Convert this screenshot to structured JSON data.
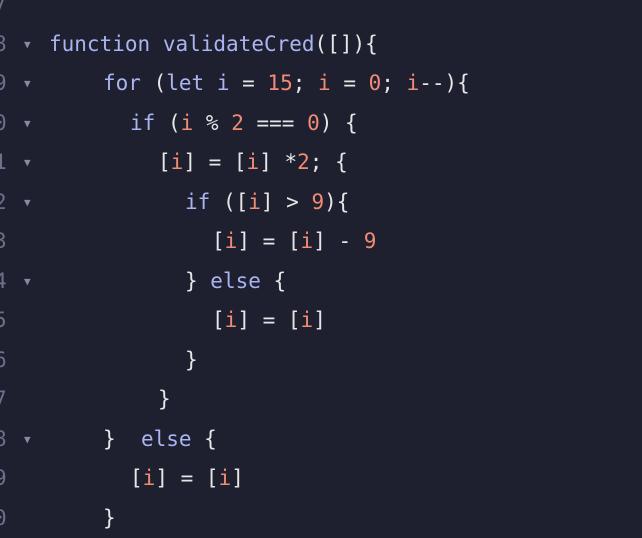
{
  "editor": {
    "fold_glyph": "▼",
    "lines": [
      {
        "no": "7",
        "fold": false,
        "indent": 0,
        "tokens": []
      },
      {
        "no": "8",
        "fold": true,
        "indent": 0,
        "tokens": [
          {
            "t": "function",
            "c": "kw"
          },
          {
            "t": " ",
            "c": "pun"
          },
          {
            "t": "validateCred",
            "c": "fn"
          },
          {
            "t": "([]){",
            "c": "pun"
          }
        ]
      },
      {
        "no": "9",
        "fold": true,
        "indent": 1,
        "tokens": [
          {
            "t": "for",
            "c": "kw"
          },
          {
            "t": " (",
            "c": "pun"
          },
          {
            "t": "let",
            "c": "kw"
          },
          {
            "t": " ",
            "c": "pun"
          },
          {
            "t": "i",
            "c": "fn"
          },
          {
            "t": " = ",
            "c": "pun"
          },
          {
            "t": "15",
            "c": "num"
          },
          {
            "t": "; ",
            "c": "pun"
          },
          {
            "t": "i",
            "c": "var"
          },
          {
            "t": " = ",
            "c": "pun"
          },
          {
            "t": "0",
            "c": "num"
          },
          {
            "t": "; ",
            "c": "pun"
          },
          {
            "t": "i",
            "c": "var"
          },
          {
            "t": "--){",
            "c": "pun"
          }
        ]
      },
      {
        "no": "0",
        "fold": true,
        "indent": 2,
        "tokens": [
          {
            "t": "if",
            "c": "kw"
          },
          {
            "t": " (",
            "c": "pun"
          },
          {
            "t": "i",
            "c": "var"
          },
          {
            "t": " % ",
            "c": "pun"
          },
          {
            "t": "2",
            "c": "num"
          },
          {
            "t": " === ",
            "c": "pun"
          },
          {
            "t": "0",
            "c": "num"
          },
          {
            "t": ") {",
            "c": "pun"
          }
        ]
      },
      {
        "no": "1",
        "fold": true,
        "indent": 3,
        "tokens": [
          {
            "t": "[",
            "c": "pun"
          },
          {
            "t": "i",
            "c": "var"
          },
          {
            "t": "] = [",
            "c": "pun"
          },
          {
            "t": "i",
            "c": "var"
          },
          {
            "t": "] *",
            "c": "pun"
          },
          {
            "t": "2",
            "c": "num"
          },
          {
            "t": "; {",
            "c": "pun"
          }
        ]
      },
      {
        "no": "2",
        "fold": true,
        "indent": 4,
        "tokens": [
          {
            "t": "if",
            "c": "kw"
          },
          {
            "t": " ([",
            "c": "pun"
          },
          {
            "t": "i",
            "c": "var"
          },
          {
            "t": "] > ",
            "c": "pun"
          },
          {
            "t": "9",
            "c": "num"
          },
          {
            "t": "){",
            "c": "pun"
          }
        ]
      },
      {
        "no": "3",
        "fold": false,
        "indent": 5,
        "tokens": [
          {
            "t": "[",
            "c": "pun"
          },
          {
            "t": "i",
            "c": "var"
          },
          {
            "t": "] = [",
            "c": "pun"
          },
          {
            "t": "i",
            "c": "var"
          },
          {
            "t": "] - ",
            "c": "pun"
          },
          {
            "t": "9",
            "c": "num"
          }
        ]
      },
      {
        "no": "4",
        "fold": true,
        "indent": 4,
        "tokens": [
          {
            "t": "} ",
            "c": "pun"
          },
          {
            "t": "else",
            "c": "kw"
          },
          {
            "t": " {",
            "c": "pun"
          }
        ]
      },
      {
        "no": "5",
        "fold": false,
        "indent": 5,
        "tokens": [
          {
            "t": "[",
            "c": "pun"
          },
          {
            "t": "i",
            "c": "var"
          },
          {
            "t": "] = [",
            "c": "pun"
          },
          {
            "t": "i",
            "c": "var"
          },
          {
            "t": "]",
            "c": "pun"
          }
        ]
      },
      {
        "no": "6",
        "fold": false,
        "indent": 4,
        "tokens": [
          {
            "t": "}",
            "c": "pun"
          }
        ]
      },
      {
        "no": "7",
        "fold": false,
        "indent": 3,
        "tokens": [
          {
            "t": "}",
            "c": "pun"
          }
        ]
      },
      {
        "no": "8",
        "fold": true,
        "indent": 1,
        "tokens": [
          {
            "t": "}  ",
            "c": "pun"
          },
          {
            "t": "else",
            "c": "kw"
          },
          {
            "t": " {",
            "c": "pun"
          }
        ]
      },
      {
        "no": "9",
        "fold": false,
        "indent": 2,
        "tokens": [
          {
            "t": "[",
            "c": "pun"
          },
          {
            "t": "i",
            "c": "var"
          },
          {
            "t": "] = [",
            "c": "pun"
          },
          {
            "t": "i",
            "c": "var"
          },
          {
            "t": "]",
            "c": "pun"
          }
        ]
      },
      {
        "no": "0",
        "fold": false,
        "indent": 1,
        "tokens": [
          {
            "t": "}",
            "c": "pun"
          }
        ]
      }
    ]
  },
  "colors": {
    "background": "#1e2030",
    "keyword": "#a9b4f0",
    "number": "#f28b74",
    "text": "#e6e6e6",
    "gutter": "#6c7089"
  }
}
